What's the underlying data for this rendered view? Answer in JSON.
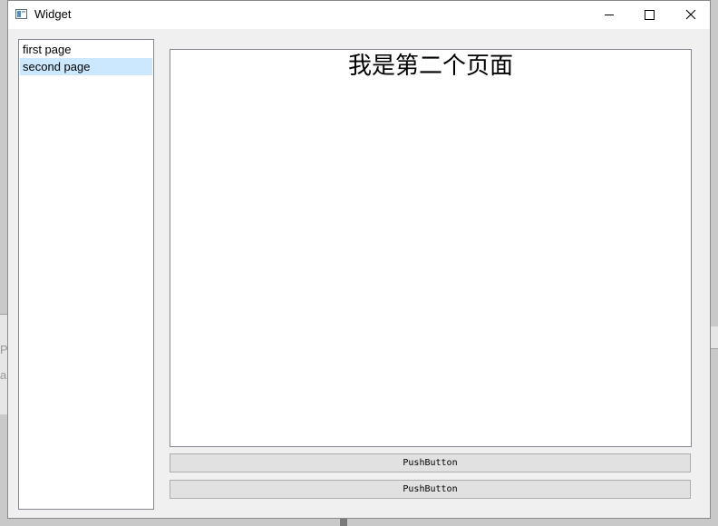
{
  "window": {
    "title": "Widget"
  },
  "background": {
    "fragment_1": "Py",
    "fragment_2": "a"
  },
  "list": {
    "items": [
      {
        "label": "first page",
        "selected": false
      },
      {
        "label": "second page",
        "selected": true
      }
    ]
  },
  "page": {
    "heading": "我是第二个页面"
  },
  "buttons": {
    "button_1": "PushButton",
    "button_2": "PushButton"
  },
  "colors": {
    "selection": "#cce8ff",
    "window_bg": "#f0f0f0",
    "button_bg": "#e1e1e1"
  },
  "icons": {
    "app": "app-window-icon",
    "minimize": "minimize-icon",
    "maximize": "maximize-icon",
    "close": "close-icon"
  }
}
